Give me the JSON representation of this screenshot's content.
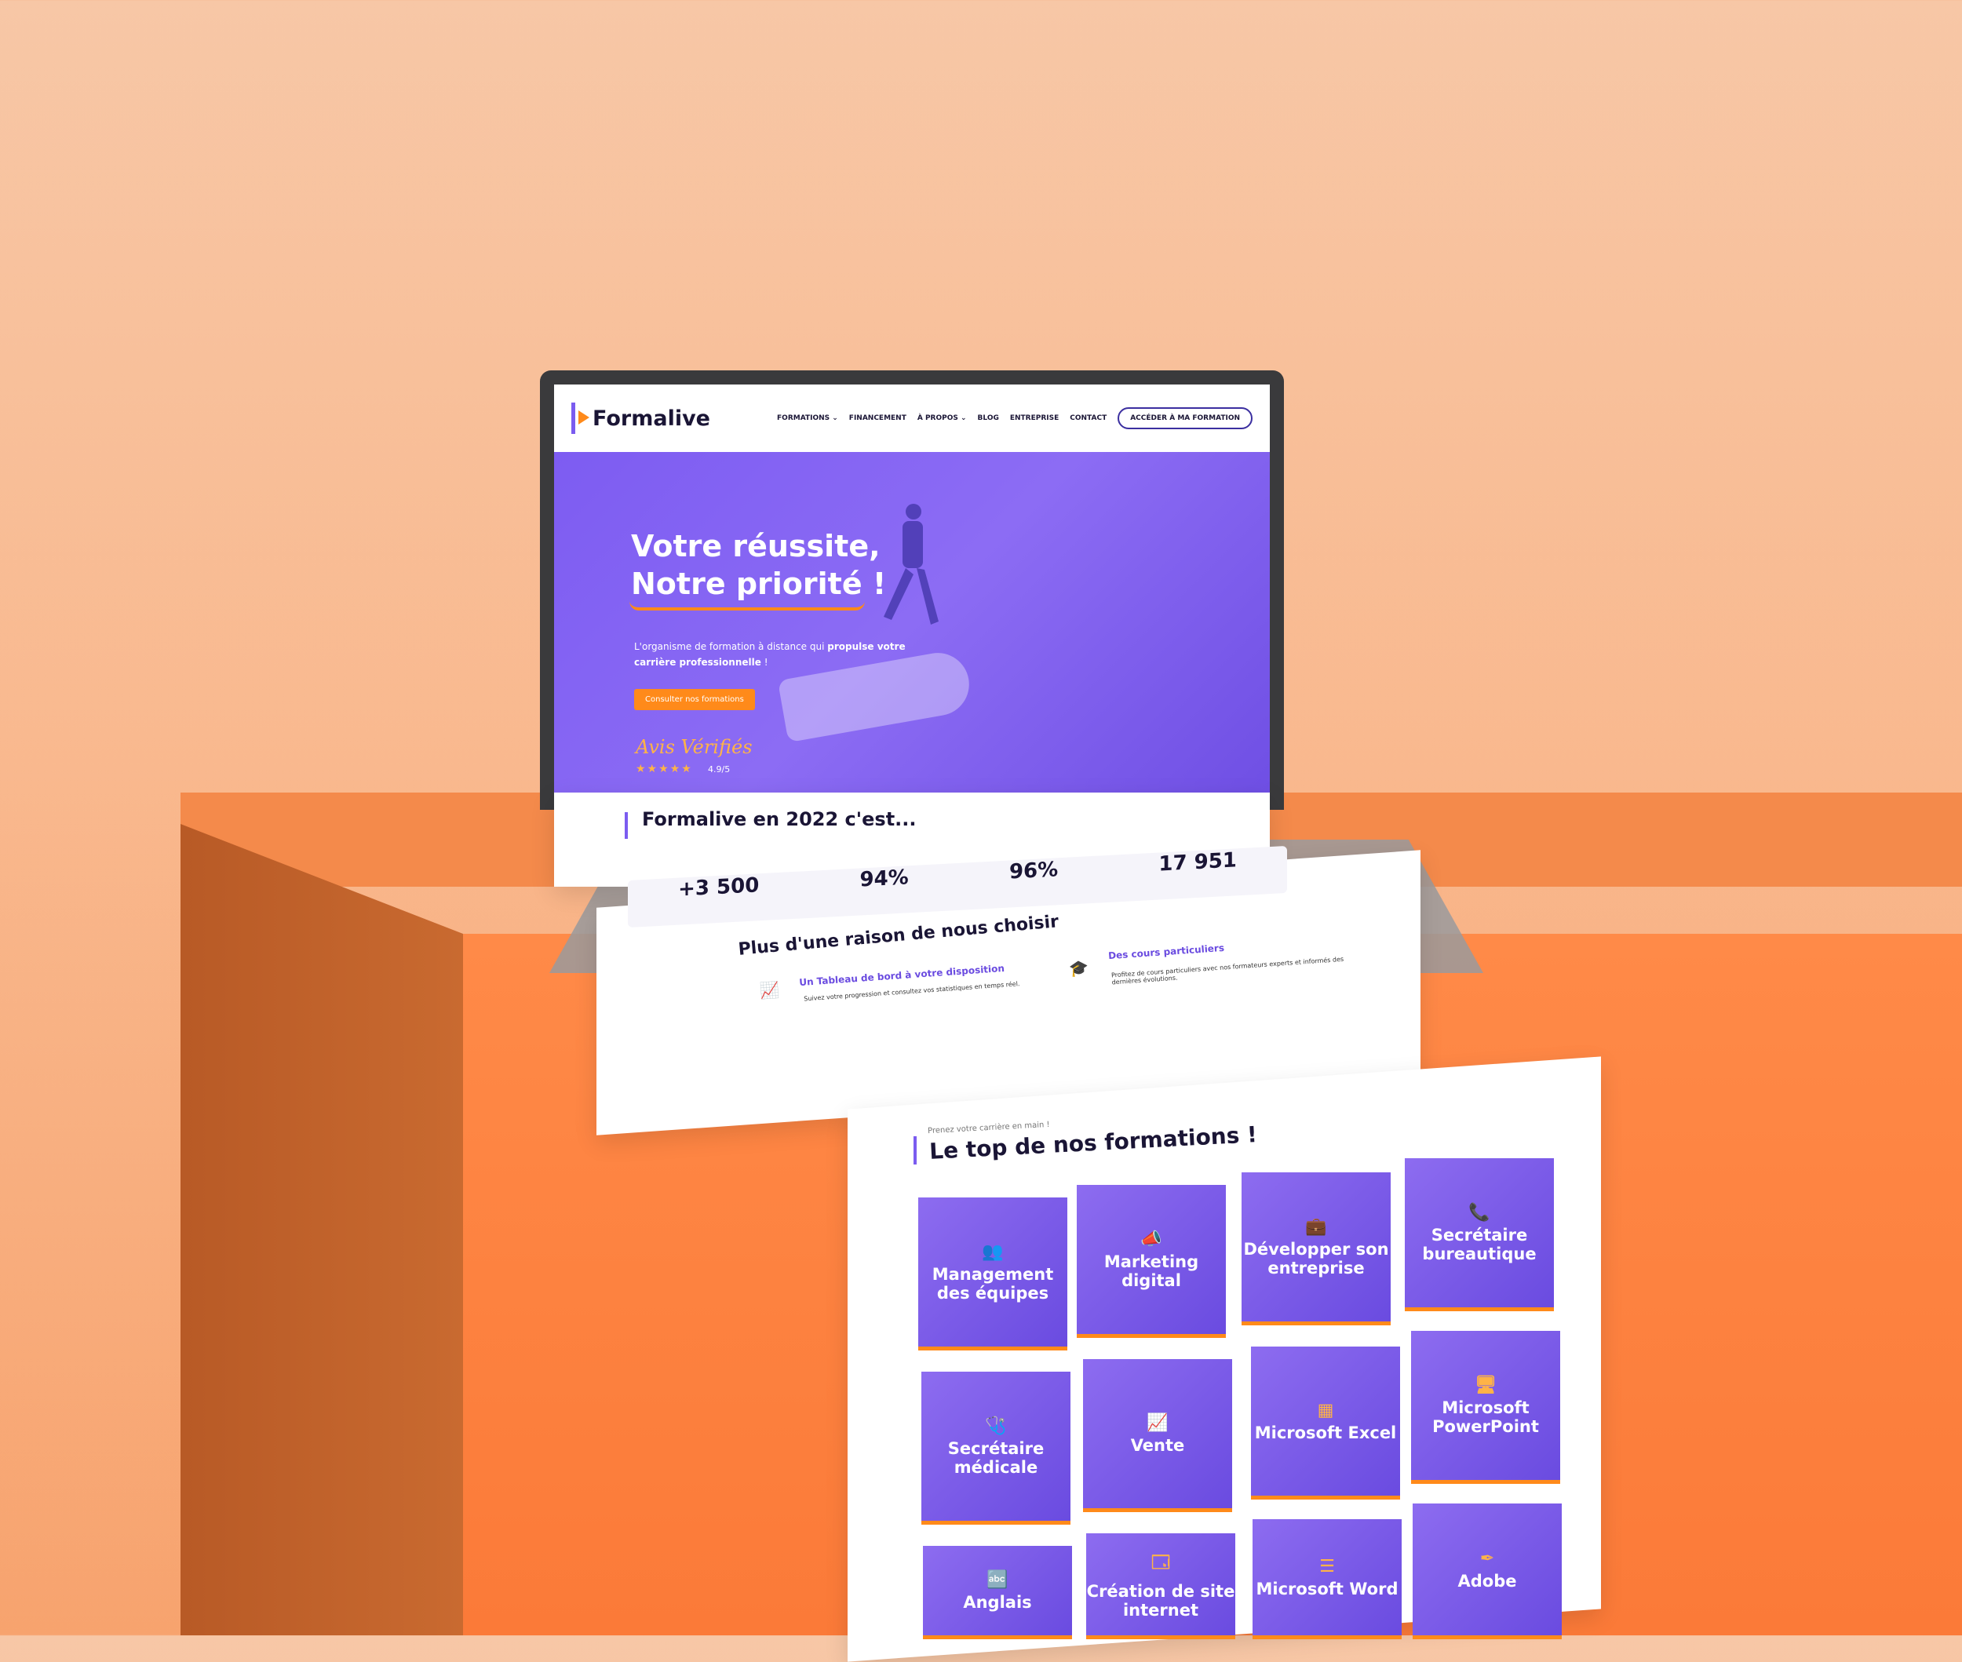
{
  "header": {
    "logo_text": "Formalive",
    "nav": [
      "FORMATIONS ⌄",
      "FINANCEMENT",
      "À PROPOS ⌄",
      "BLOG",
      "ENTREPRISE",
      "CONTACT"
    ],
    "cta_button": "ACCÉDER À MA FORMATION"
  },
  "hero": {
    "title_line1": "Votre réussite,",
    "title_line2": "Notre priorité !",
    "desc_prefix": "L'organisme de formation à distance qui",
    "desc_bold1": "propulse votre",
    "desc_bold2": "carrière professionnelle",
    "desc_suffix": "!",
    "cta": "Consulter nos formations",
    "avis": "Avis Vérifiés",
    "stars": "★★★★★",
    "rating": "4.9/5"
  },
  "stats_section": {
    "title": "Formalive en 2022 c'est...",
    "stats": [
      {
        "value": "+3 500"
      },
      {
        "value": "94%"
      },
      {
        "value": "96%"
      },
      {
        "value": "17 951"
      }
    ]
  },
  "reasons": {
    "title": "Plus d'une raison de nous choisir",
    "items": [
      {
        "title": "Un Tableau de bord à votre disposition",
        "desc": "Suivez votre progression et consultez vos statistiques en temps réel."
      },
      {
        "title": "Des cours particuliers",
        "desc": "Profitez de cours particuliers avec nos formateurs experts et informés des dernières évolutions."
      }
    ]
  },
  "formations": {
    "subtitle": "Prenez votre carrière en main !",
    "title": "Le top de nos formations !",
    "tiles": [
      {
        "label": "Management des équipes"
      },
      {
        "label": "Marketing digital"
      },
      {
        "label": "Développer son entreprise"
      },
      {
        "label": "Secrétaire bureautique"
      },
      {
        "label": "Secrétaire médicale"
      },
      {
        "label": "Vente"
      },
      {
        "label": "Microsoft Excel"
      },
      {
        "label": "Microsoft PowerPoint"
      },
      {
        "label": "Anglais"
      },
      {
        "label": "Création de site internet"
      },
      {
        "label": "Microsoft Word"
      },
      {
        "label": "Adobe"
      }
    ]
  },
  "colors": {
    "brand_purple": "#7b5cf0",
    "brand_orange": "#ff8a1a",
    "background_peach": "#f9b98f"
  }
}
